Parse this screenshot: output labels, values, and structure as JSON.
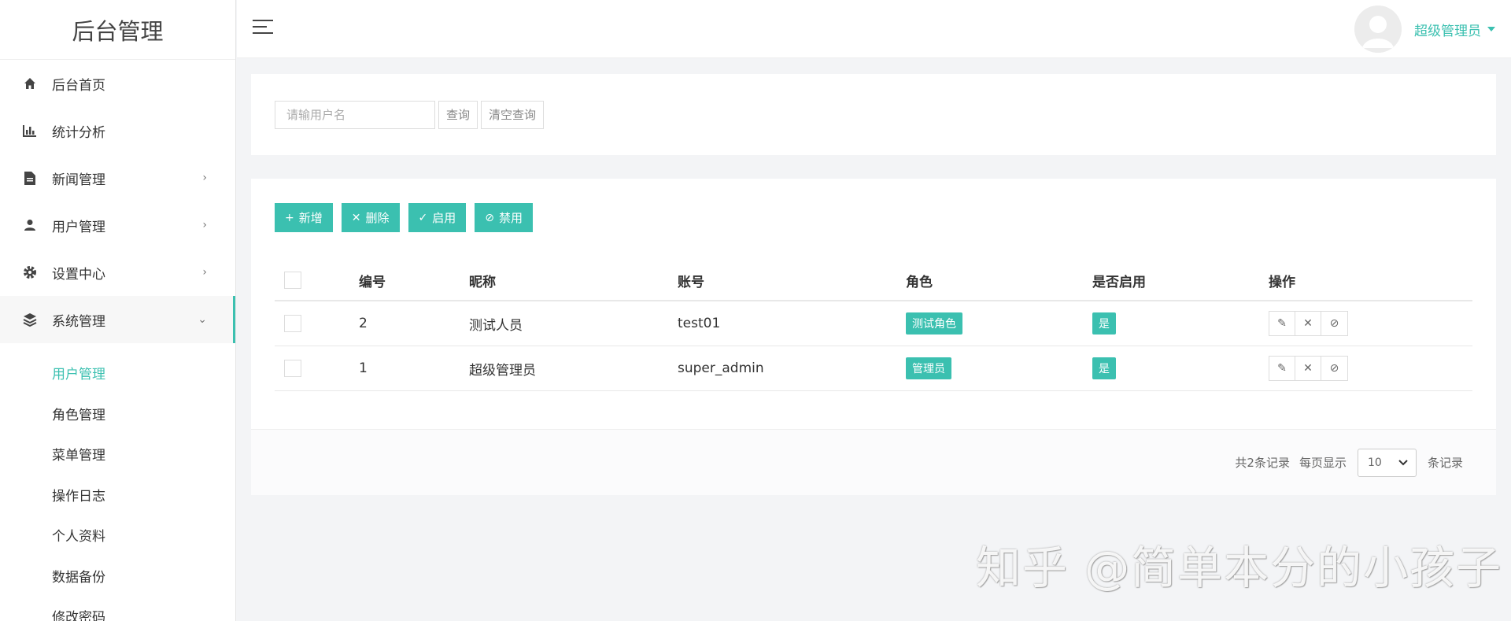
{
  "sidebar": {
    "brand": "后台管理",
    "items": [
      {
        "label": "后台首页",
        "icon": "home-icon",
        "has_children": false
      },
      {
        "label": "统计分析",
        "icon": "bar-chart-icon",
        "has_children": false
      },
      {
        "label": "新闻管理",
        "icon": "document-icon",
        "has_children": true
      },
      {
        "label": "用户管理",
        "icon": "user-icon",
        "has_children": true
      },
      {
        "label": "设置中心",
        "icon": "gear-icon",
        "has_children": true
      },
      {
        "label": "系统管理",
        "icon": "layers-icon",
        "has_children": true,
        "expanded": true
      }
    ],
    "sub_items": [
      "用户管理",
      "角色管理",
      "菜单管理",
      "操作日志",
      "个人资料",
      "数据备份",
      "修改密码"
    ],
    "active_sub_index": 0
  },
  "topbar": {
    "user_name": "超级管理员"
  },
  "search": {
    "placeholder": "请输用户名",
    "query_label": "查询",
    "clear_label": "清空查询"
  },
  "toolbar": {
    "add_label": "新增",
    "delete_label": "删除",
    "enable_label": "启用",
    "disable_label": "禁用"
  },
  "table": {
    "headers": {
      "id": "编号",
      "nickname": "昵称",
      "account": "账号",
      "role": "角色",
      "enabled": "是否启用",
      "actions": "操作"
    },
    "rows": [
      {
        "id": "2",
        "nickname": "测试人员",
        "account": "test01",
        "role": "测试角色",
        "enabled": "是"
      },
      {
        "id": "1",
        "nickname": "超级管理员",
        "account": "super_admin",
        "role": "管理员",
        "enabled": "是"
      }
    ]
  },
  "pagination": {
    "total_text": "共2条记录",
    "per_page_label": "每页显示",
    "per_page_value": "10",
    "suffix": "条记录"
  },
  "watermark": "知乎 @简单本分的小孩子",
  "colors": {
    "accent": "#3bc0b0"
  }
}
